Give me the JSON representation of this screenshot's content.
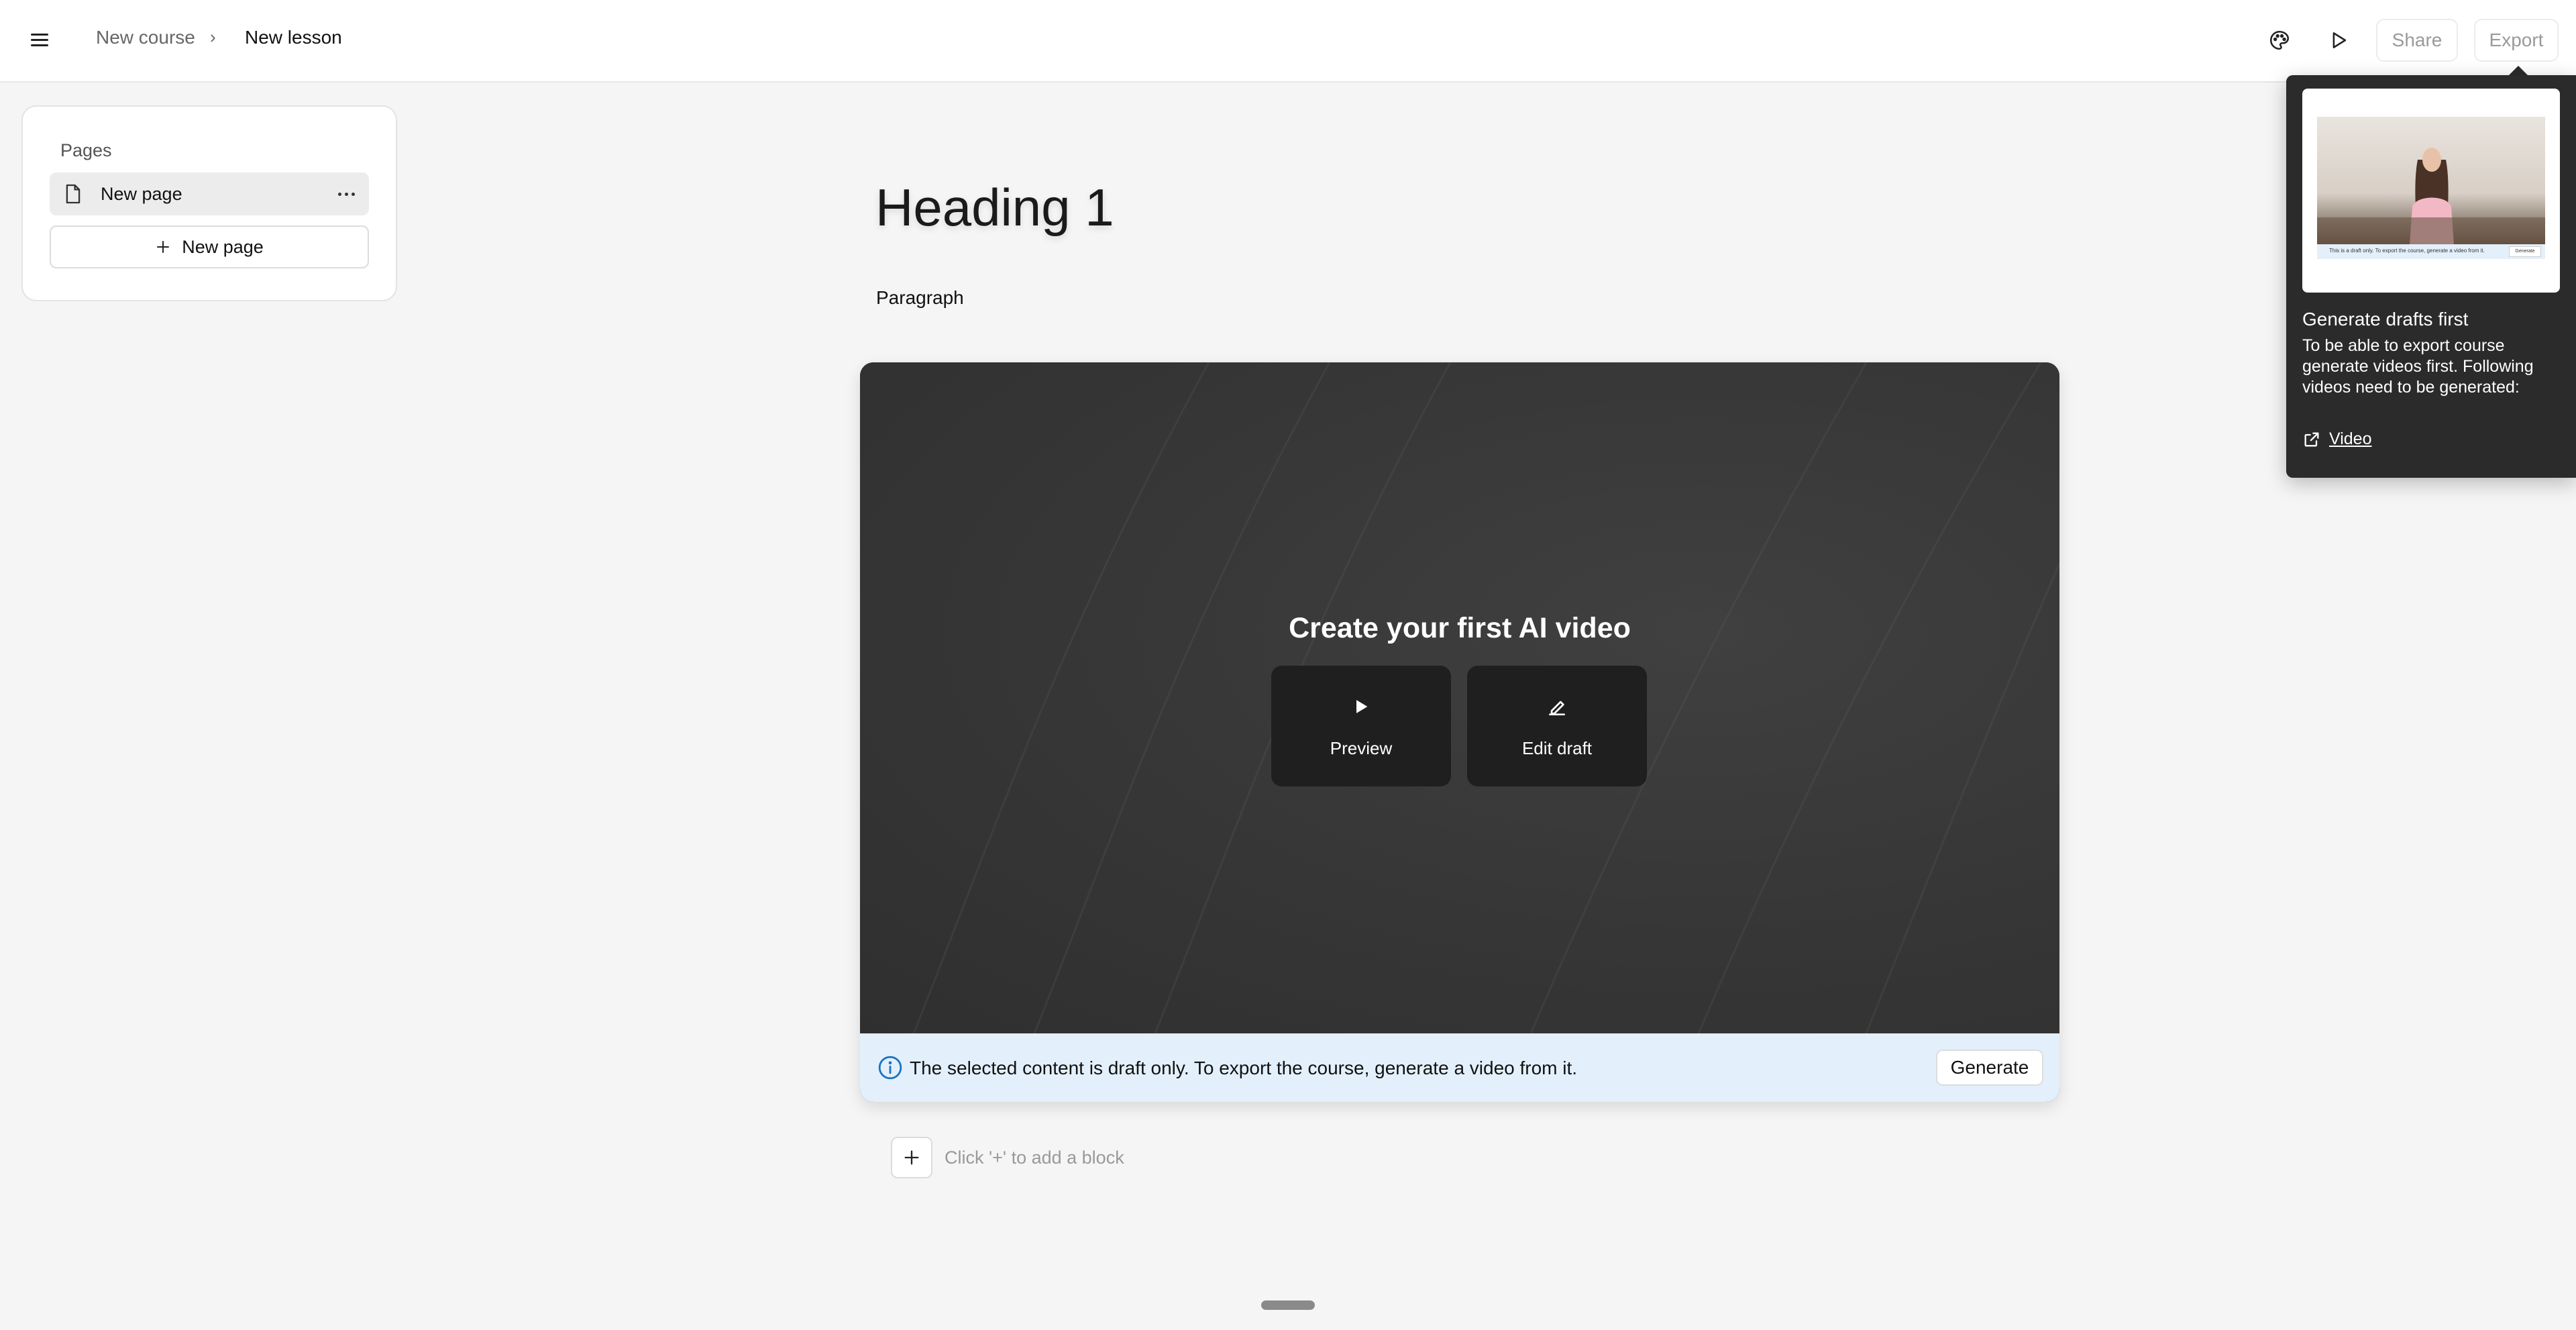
{
  "breadcrumb": {
    "course": "New course",
    "separator": "›",
    "lesson": "New lesson"
  },
  "toolbar": {
    "share_label": "Share",
    "export_label": "Export",
    "theme_icon": "palette-icon",
    "play_icon": "play-icon"
  },
  "sidebar": {
    "title": "Pages",
    "pages": [
      {
        "label": "New page"
      }
    ],
    "new_page_label": "New page"
  },
  "editor": {
    "heading": "Heading 1",
    "paragraph": "Paragraph",
    "video_block": {
      "title": "Create your first AI video",
      "preview_label": "Preview",
      "edit_label": "Edit draft",
      "draft_notice": "The selected content is draft only. To export the course, generate a video from it.",
      "generate_label": "Generate"
    },
    "add_block_hint": "Click '+' to add a block"
  },
  "tooltip": {
    "title": "Generate drafts first",
    "body": "To be able to export course generate videos first. Following videos need to be generated:",
    "link_label": "Video",
    "thumb_notice": "This is a draft only. To export the course, generate a video from it.",
    "thumb_button": "Generate"
  },
  "colors": {
    "accent": "#1a73c8",
    "notice_bg": "#e3f0fb",
    "tooltip_bg": "#2b2b2b",
    "video_bg": "#3a3a3a"
  }
}
